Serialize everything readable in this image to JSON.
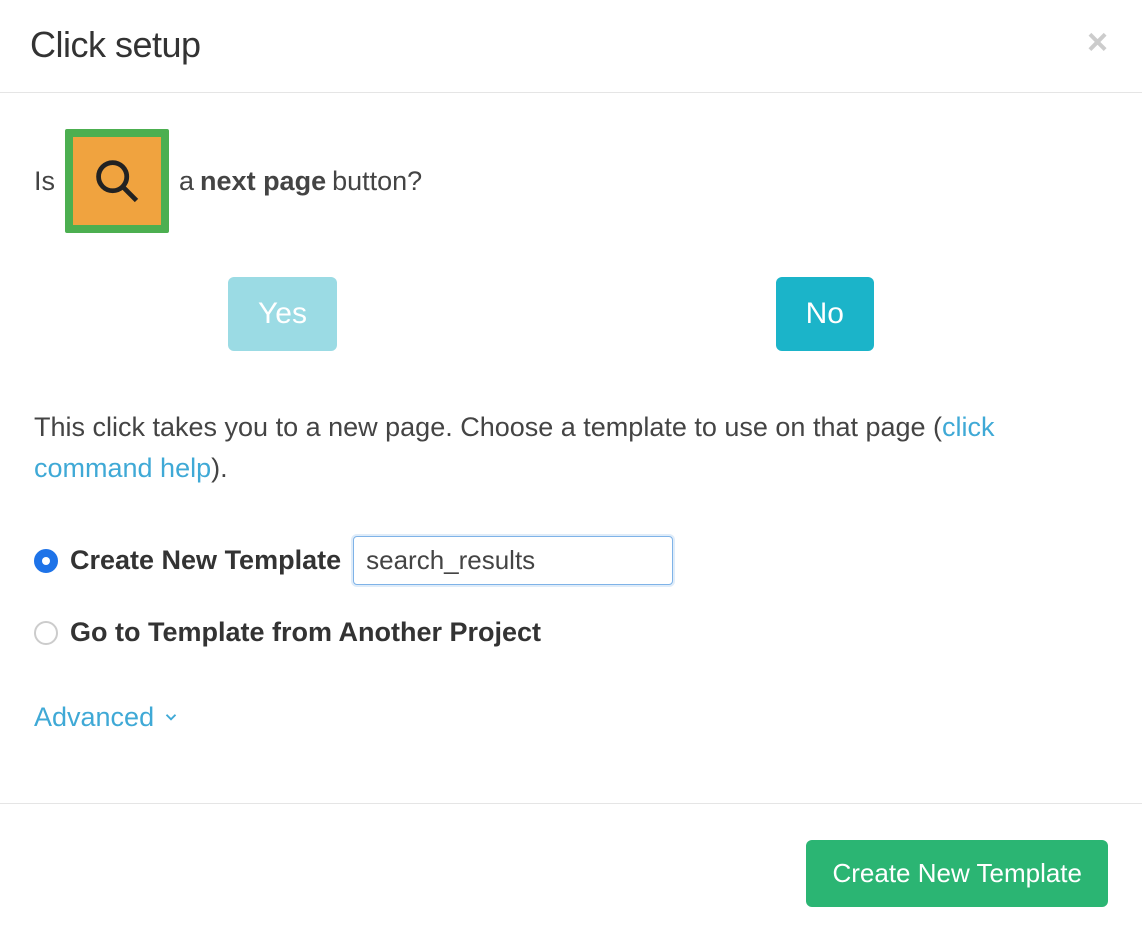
{
  "header": {
    "title": "Click setup",
    "close_icon": "×"
  },
  "body": {
    "question": {
      "part1": "Is",
      "part2": "a",
      "bold": "next page",
      "part3": "button?"
    },
    "yes_label": "Yes",
    "no_label": "No",
    "description_part1": "This click takes you to a new page. Choose a template to use on that page (",
    "help_link": "click command help",
    "description_part2": ").",
    "options": {
      "create_label": "Create New Template",
      "create_value": "search_results",
      "goto_label": "Go to Template from Another Project"
    },
    "advanced_label": "Advanced"
  },
  "footer": {
    "primary_label": "Create New Template"
  },
  "colors": {
    "accent_teal": "#1bb4c9",
    "accent_teal_light": "#9bdbe4",
    "link_blue": "#3fa9d6",
    "primary_green": "#2bb573",
    "thumb_orange": "#f0a33f",
    "thumb_border_green": "#4caf50",
    "radio_selected": "#1e73e8"
  }
}
